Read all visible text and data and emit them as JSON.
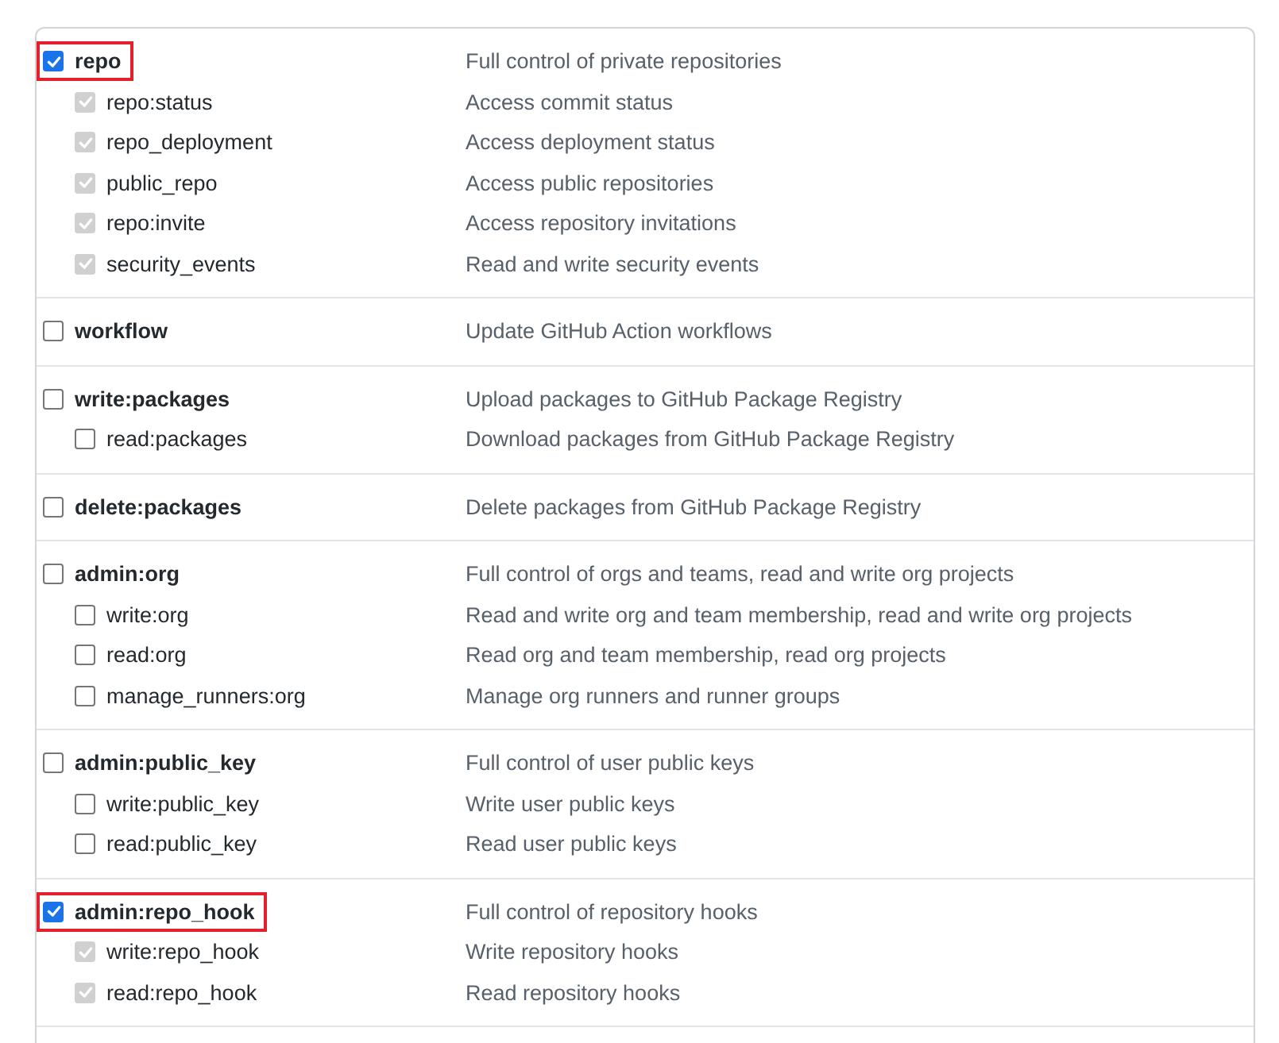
{
  "scopes": [
    {
      "name": "repo",
      "description": "Full control of private repositories",
      "checked": true,
      "highlighted": true,
      "children": [
        {
          "name": "repo:status",
          "description": "Access commit status",
          "checked": true,
          "disabled": true
        },
        {
          "name": "repo_deployment",
          "description": "Access deployment status",
          "checked": true,
          "disabled": true
        },
        {
          "name": "public_repo",
          "description": "Access public repositories",
          "checked": true,
          "disabled": true
        },
        {
          "name": "repo:invite",
          "description": "Access repository invitations",
          "checked": true,
          "disabled": true
        },
        {
          "name": "security_events",
          "description": "Read and write security events",
          "checked": true,
          "disabled": true
        }
      ]
    },
    {
      "name": "workflow",
      "description": "Update GitHub Action workflows",
      "checked": false,
      "highlighted": false
    },
    {
      "name": "write:packages",
      "description": "Upload packages to GitHub Package Registry",
      "checked": false,
      "highlighted": false,
      "children": [
        {
          "name": "read:packages",
          "description": "Download packages from GitHub Package Registry",
          "checked": false,
          "disabled": false
        }
      ]
    },
    {
      "name": "delete:packages",
      "description": "Delete packages from GitHub Package Registry",
      "checked": false,
      "highlighted": false
    },
    {
      "name": "admin:org",
      "description": "Full control of orgs and teams, read and write org projects",
      "checked": false,
      "highlighted": false,
      "children": [
        {
          "name": "write:org",
          "description": "Read and write org and team membership, read and write org projects",
          "checked": false,
          "disabled": false
        },
        {
          "name": "read:org",
          "description": "Read org and team membership, read org projects",
          "checked": false,
          "disabled": false
        },
        {
          "name": "manage_runners:org",
          "description": "Manage org runners and runner groups",
          "checked": false,
          "disabled": false
        }
      ]
    },
    {
      "name": "admin:public_key",
      "description": "Full control of user public keys",
      "checked": false,
      "highlighted": false,
      "children": [
        {
          "name": "write:public_key",
          "description": "Write user public keys",
          "checked": false,
          "disabled": false
        },
        {
          "name": "read:public_key",
          "description": "Read user public keys",
          "checked": false,
          "disabled": false
        }
      ]
    },
    {
      "name": "admin:repo_hook",
      "description": "Full control of repository hooks",
      "checked": true,
      "highlighted": true,
      "children": [
        {
          "name": "write:repo_hook",
          "description": "Write repository hooks",
          "checked": true,
          "disabled": true
        },
        {
          "name": "read:repo_hook",
          "description": "Read repository hooks",
          "checked": true,
          "disabled": true
        }
      ]
    }
  ]
}
